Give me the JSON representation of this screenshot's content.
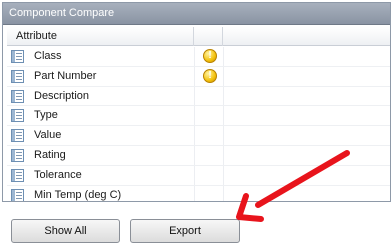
{
  "panel": {
    "title": "Component Compare"
  },
  "grid": {
    "header": {
      "attribute": "Attribute"
    },
    "rows": [
      {
        "label": "Class",
        "warning": true
      },
      {
        "label": "Part Number",
        "warning": true
      },
      {
        "label": "Description",
        "warning": false
      },
      {
        "label": "Type",
        "warning": false
      },
      {
        "label": "Value",
        "warning": false
      },
      {
        "label": "Rating",
        "warning": false
      },
      {
        "label": "Tolerance",
        "warning": false
      },
      {
        "label": "Min Temp (deg C)",
        "warning": false
      }
    ]
  },
  "buttons": {
    "show_all": "Show All",
    "export": "Export"
  },
  "colors": {
    "title_bar": "#8a94a3",
    "arrow": "#e8141c",
    "warning": "#f4c20d"
  },
  "icons": {
    "row_icon": "table-row-icon",
    "warning_icon": "warning-icon",
    "annotation": "red-arrow-annotation"
  }
}
